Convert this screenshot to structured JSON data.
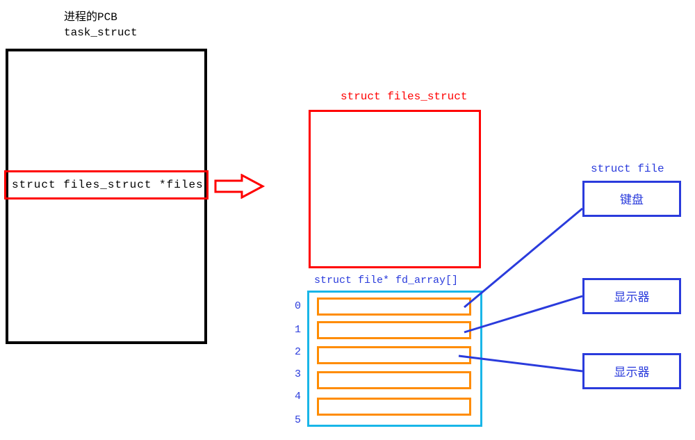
{
  "titles": {
    "pcb_title": "进程的PCB",
    "task_struct": "task_struct",
    "files_struct": "struct files_struct",
    "fd_array": "struct file* fd_array[]",
    "struct_file": "struct file"
  },
  "pcb": {
    "files_pointer": "struct files_struct *files"
  },
  "fd_indices": [
    "0",
    "1",
    "2",
    "3",
    "4",
    "5"
  ],
  "files": [
    {
      "label": "键盘"
    },
    {
      "label": "显示器"
    },
    {
      "label": "显示器"
    }
  ],
  "colors": {
    "black": "#000000",
    "red": "#ff0000",
    "blue": "#2a3bdc",
    "orange": "#ff8c00",
    "cyan": "#19b6e8"
  }
}
